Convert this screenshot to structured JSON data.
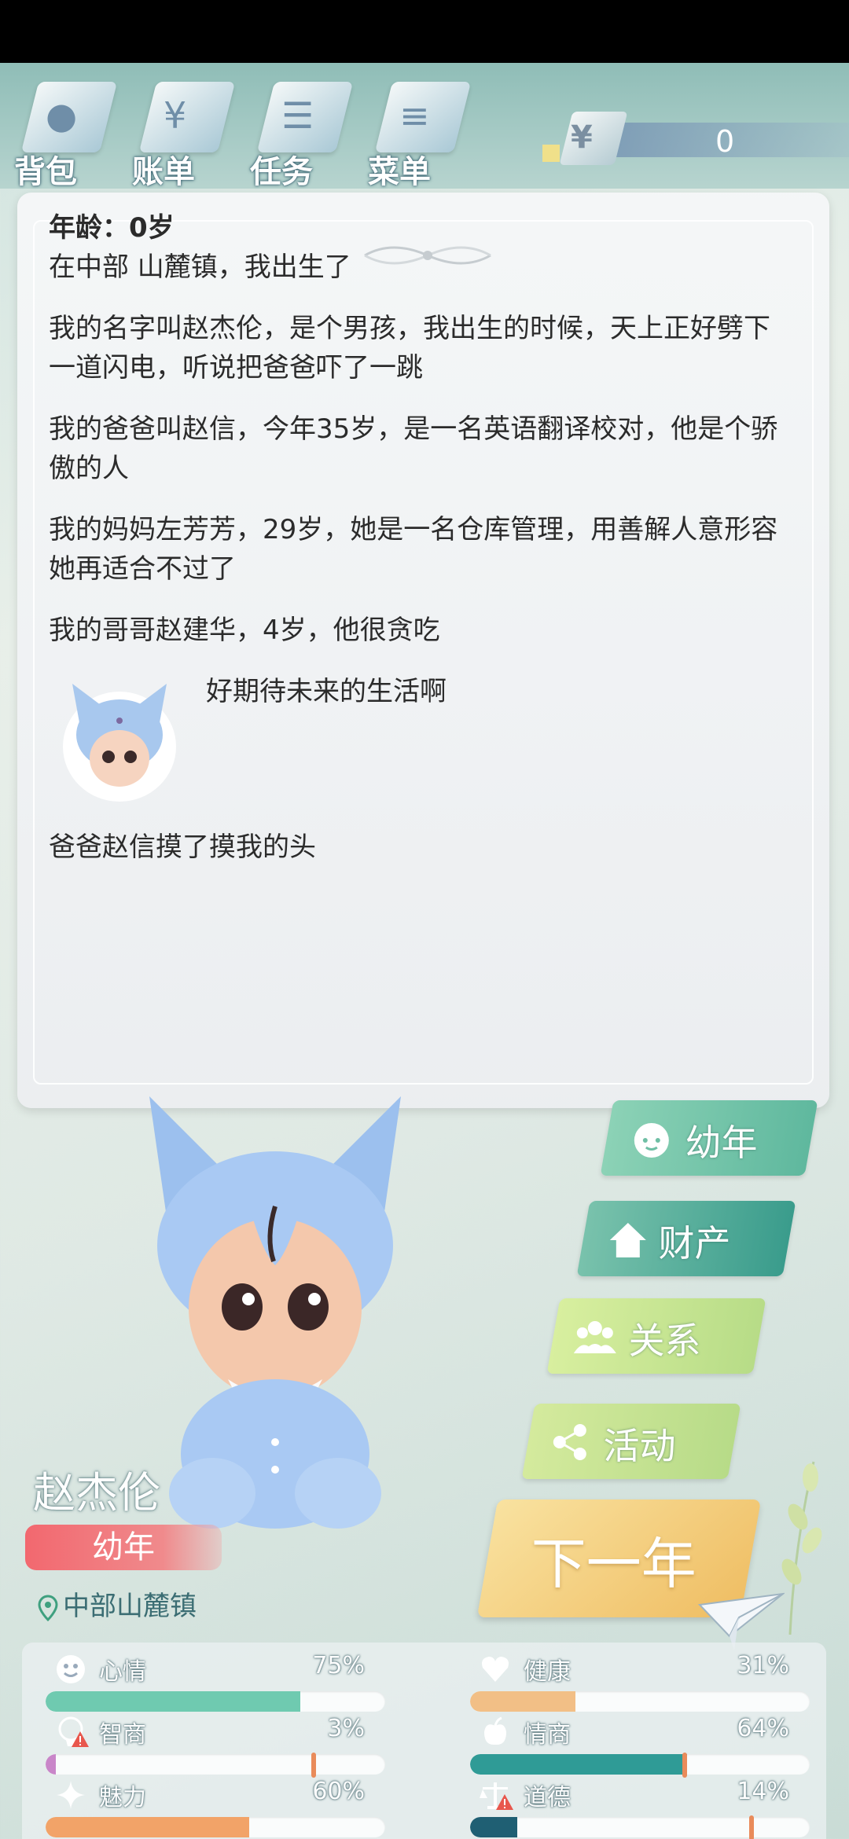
{
  "menu": {
    "items": [
      {
        "label": "背包",
        "icon": "bag-icon"
      },
      {
        "label": "账单",
        "icon": "bill-icon"
      },
      {
        "label": "任务",
        "icon": "task-icon"
      },
      {
        "label": "菜单",
        "icon": "menu-icon"
      }
    ],
    "money_symbol": "¥",
    "money_value": "0"
  },
  "story": {
    "age_line": "年龄：0岁",
    "paragraphs": [
      "在中部 山麓镇，我出生了",
      "我的名字叫赵杰伦，是个男孩，我出生的时候，天上正好劈下一道闪电，听说把爸爸吓了一跳",
      "我的爸爸叫赵信，今年35岁，是一名英语翻译校对，他是个骄傲的人",
      "我的妈妈左芳芳，29岁，她是一名仓库管理，用善解人意形容她再适合不过了",
      "我的哥哥赵建华，4岁，他很贪吃"
    ],
    "thought": "好期待未来的生活啊",
    "last_line": "爸爸赵信摸了摸我的头"
  },
  "character": {
    "name": "赵杰伦",
    "stage": "幼年",
    "location": "中部山麓镇"
  },
  "actions": {
    "stage": "幼年",
    "property": "财产",
    "relations": "关系",
    "activities": "活动",
    "next_year": "下一年"
  },
  "stats": [
    {
      "name": "心情",
      "value": "75%",
      "level": 0.75,
      "color": "#6fcab0",
      "icon": "smile-icon"
    },
    {
      "name": "健康",
      "value": "31%",
      "level": 0.31,
      "color": "#f2bf86",
      "icon": "heart-icon"
    },
    {
      "name": "智商",
      "value": "3%",
      "level": 0.03,
      "color": "#c986c9",
      "icon": "brain-icon",
      "warning": true
    },
    {
      "name": "情商",
      "value": "64%",
      "level": 0.64,
      "color": "#2f9b96",
      "icon": "apple-icon"
    },
    {
      "name": "魅力",
      "value": "60%",
      "level": 0.6,
      "color": "#f2a368",
      "icon": "sparkle-icon"
    },
    {
      "name": "道德",
      "value": "14%",
      "level": 0.14,
      "color": "#1f5f73",
      "icon": "scales-icon",
      "warning": true
    }
  ]
}
